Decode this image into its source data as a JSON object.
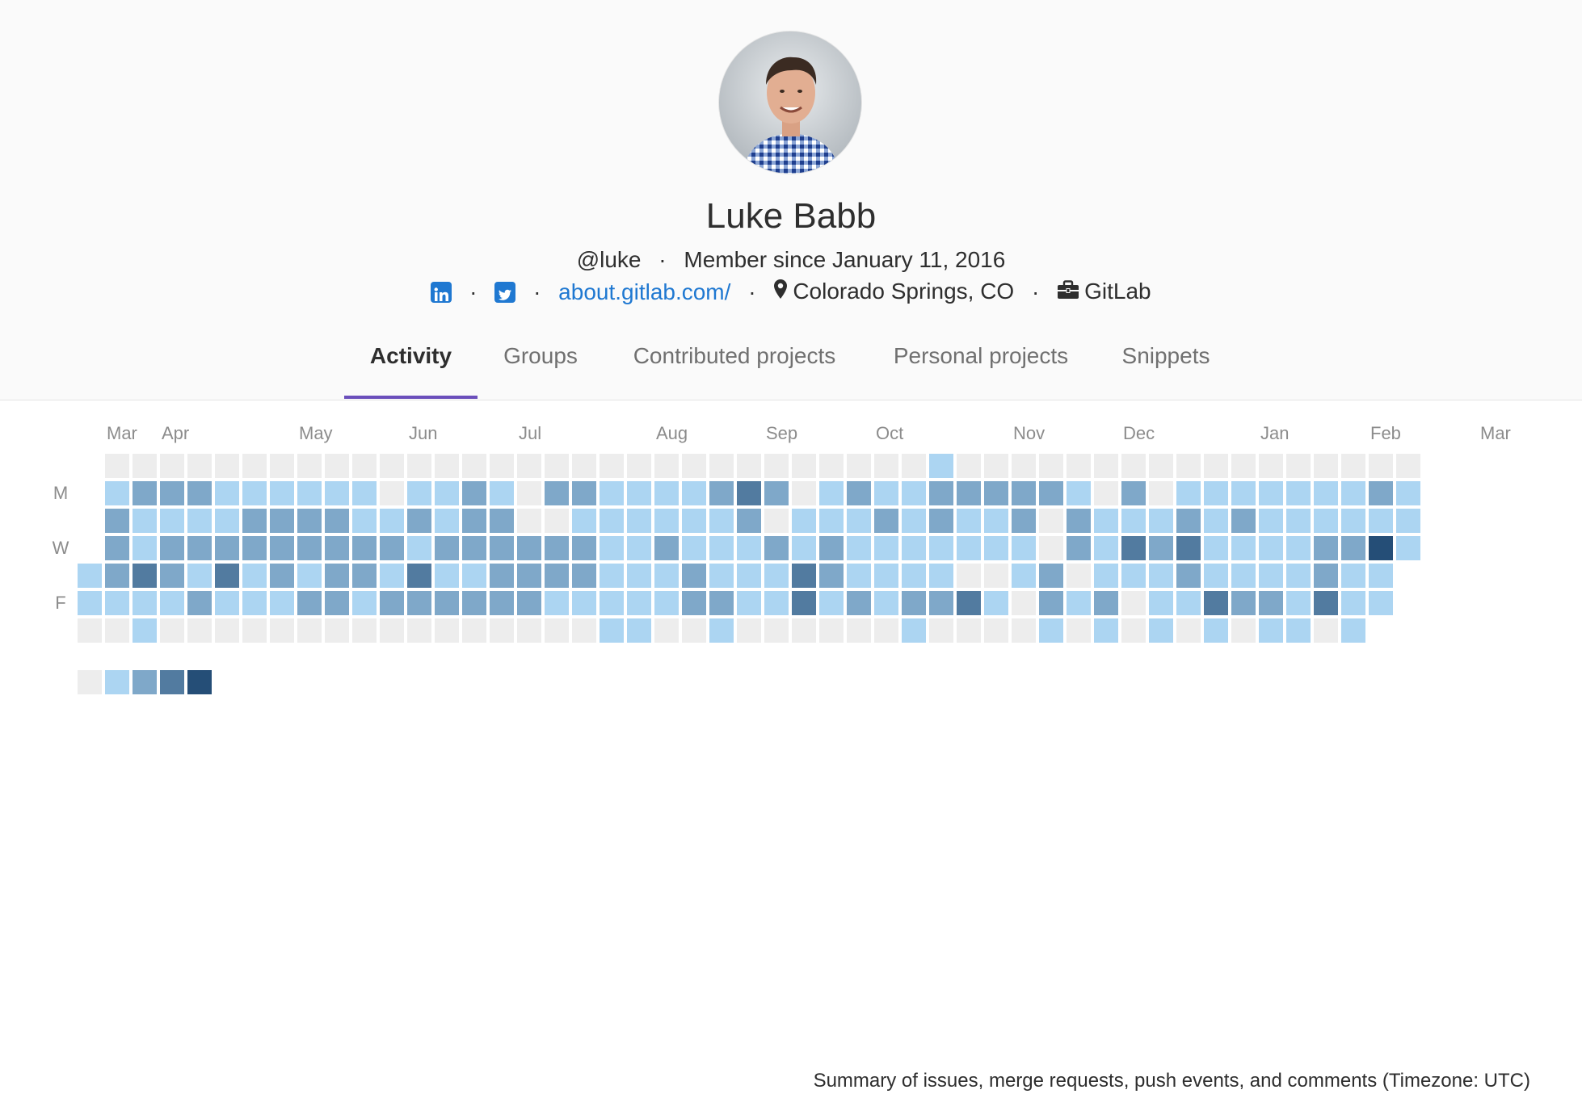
{
  "profile": {
    "name": "Luke Babb",
    "username": "@luke",
    "member_since": "Member since January 11, 2016",
    "website": "about.gitlab.com/",
    "location": "Colorado Springs, CO",
    "organization": "GitLab",
    "separator": "·",
    "icons": {
      "linkedin": "linkedin-icon",
      "twitter": "twitter-icon",
      "location": "map-marker-icon",
      "organization": "briefcase-icon"
    }
  },
  "tabs": [
    {
      "label": "Activity",
      "active": true
    },
    {
      "label": "Groups",
      "active": false
    },
    {
      "label": "Contributed projects",
      "active": false
    },
    {
      "label": "Personal projects",
      "active": false
    },
    {
      "label": "Snippets",
      "active": false
    }
  ],
  "colors": {
    "accent": "#6b4fbb",
    "link": "#1f78d1",
    "levels": [
      "#ededed",
      "#acd5f2",
      "#7fa8c9",
      "#527ba0",
      "#254e77"
    ]
  },
  "calendar": {
    "months": [
      "Mar",
      "Apr",
      "May",
      "Jun",
      "Jul",
      "Aug",
      "Sep",
      "Oct",
      "Nov",
      "Dec",
      "Jan",
      "Feb",
      "Mar"
    ],
    "day_labels": [
      "M",
      "W",
      "F"
    ],
    "grid": [
      "-000000000000000000000000000000100000000000000000",
      "-122211111101121022111123201211222221020111111121",
      "-211112222112122001111112011121211202111212111111",
      "-212222222221222222112111212111111102132311112241",
      "123213121221311222211121113211110012011121111211",
      "111121112212222221111122113121223102120113221311",
      "00100000000000000001100100000010000101010101101--"
    ],
    "summary": "Summary of issues, merge requests, push events, and comments (Timezone: UTC)"
  }
}
